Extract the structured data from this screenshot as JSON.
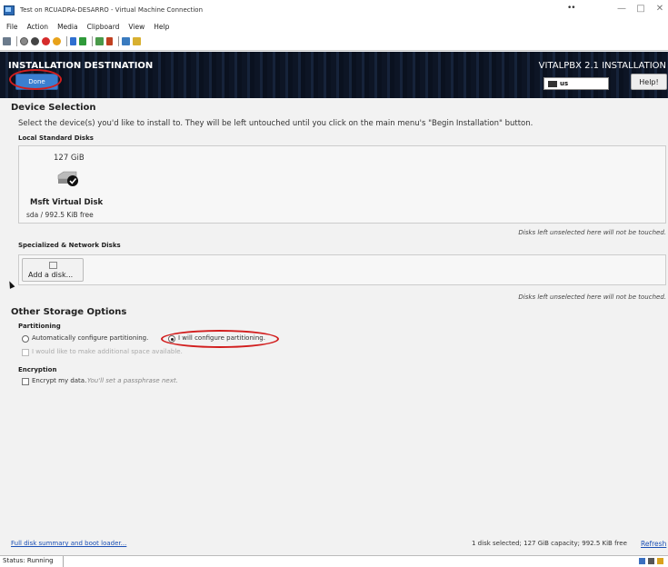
{
  "window": {
    "title": "Test on RCUADRA-DESARRO - Virtual Machine Connection",
    "dots": "••",
    "minimize": "—",
    "maximize": "□",
    "close": "✕"
  },
  "menu": [
    "File",
    "Action",
    "Media",
    "Clipboard",
    "View",
    "Help"
  ],
  "toolbar_icons": [
    "ctrl-alt-del-icon",
    "start-icon",
    "turn-off-icon",
    "shutdown-icon",
    "save-icon",
    "pause-icon",
    "resume-icon",
    "checkpoint-icon",
    "revert-icon",
    "enhanced-session-icon",
    "share-icon"
  ],
  "header": {
    "title": "INSTALLATION DESTINATION",
    "product": "VITALPBX 2.1 INSTALLATION",
    "done_label": "Done",
    "keyboard_layout": "us",
    "help_label": "Help!"
  },
  "device_selection": {
    "heading": "Device Selection",
    "instructions": "Select the device(s) you'd like to install to.  They will be left untouched until you click on the main menu's \"Begin Installation\" button.",
    "local_heading": "Local Standard Disks",
    "disk": {
      "size": "127 GiB",
      "name": "Msft Virtual Disk",
      "free": "sda  /  992.5 KiB free"
    },
    "unselected_note": "Disks left unselected here will not be touched.",
    "network_heading": "Specialized & Network Disks",
    "add_disk_label": "Add a disk..."
  },
  "other_storage": {
    "heading": "Other Storage Options",
    "partitioning_heading": "Partitioning",
    "auto_label": "Automatically configure partitioning.",
    "manual_label": "I will configure partitioning.",
    "selected": "manual",
    "extra_space_label": "I would like to make additional space available.",
    "encryption_heading": "Encryption",
    "encrypt_label": "Encrypt my data.",
    "encrypt_hint": "You'll set a passphrase next."
  },
  "footer": {
    "summary_link": "Full disk summary and boot loader...",
    "summary_text": "1 disk selected; 127 GiB capacity; 992.5 KiB free",
    "refresh_link": "Refresh"
  },
  "status": {
    "text": "Status: Running"
  },
  "colors": {
    "done_button": "#3b7fd0",
    "highlight_ring": "#d21e1e",
    "header_bg": "#0d1525",
    "link": "#1a4fb5"
  }
}
